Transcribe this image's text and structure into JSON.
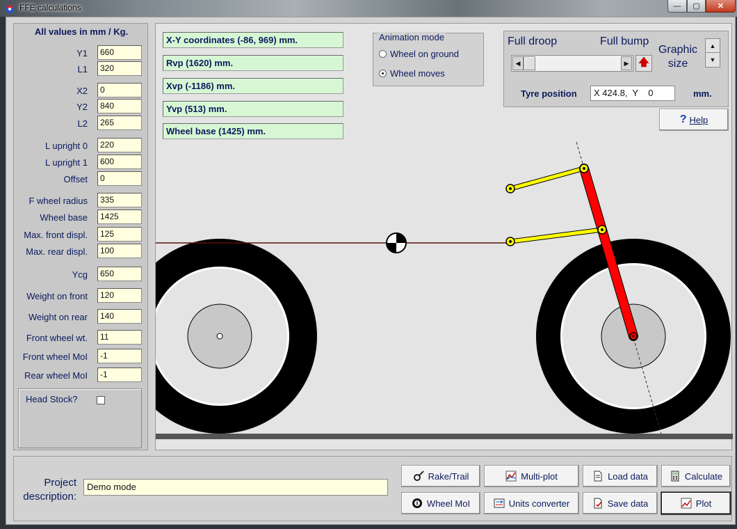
{
  "window": {
    "title": "FFE calculations",
    "minimize": "—",
    "maximize": "▢",
    "close": "✕"
  },
  "left_panel": {
    "header": "All values in mm / Kg.",
    "params": [
      {
        "label": "Y1",
        "value": "660"
      },
      {
        "label": "L1",
        "value": "320"
      },
      {
        "label": "X2",
        "value": "0"
      },
      {
        "label": "Y2",
        "value": "840"
      },
      {
        "label": "L2",
        "value": "265"
      },
      {
        "label": "L upright 0",
        "value": "220"
      },
      {
        "label": "L upright 1",
        "value": "600"
      },
      {
        "label": "Offset",
        "value": "0"
      },
      {
        "label": "F wheel radius",
        "value": "335"
      },
      {
        "label": "Wheel base",
        "value": "1425"
      },
      {
        "label": "Max. front displ.",
        "value": "125"
      },
      {
        "label": "Max. rear displ.",
        "value": "100"
      },
      {
        "label": "Ycg",
        "value": "650"
      },
      {
        "label": "Weight on front",
        "value": "120"
      },
      {
        "label": "Weight on rear",
        "value": "140"
      },
      {
        "label": "Front wheel wt.",
        "value": "11"
      },
      {
        "label": "Front wheel MoI",
        "value": "-1"
      },
      {
        "label": "Rear wheel MoI",
        "value": "-1"
      }
    ],
    "head_stock_label": "Head Stock?",
    "head_stock_checked": false
  },
  "info": [
    "X-Y coordinates (-86, 969) mm.",
    "Rvp (1620) mm.",
    "Xvp (-1186) mm.",
    "Yvp (513) mm.",
    "Wheel base (1425) mm."
  ],
  "animation": {
    "legend": "Animation mode",
    "options": [
      {
        "label": "Wheel on ground",
        "checked": false
      },
      {
        "label": "Wheel moves",
        "checked": true
      }
    ]
  },
  "controls": {
    "full_droop": "Full droop",
    "full_bump": "Full bump",
    "graphic_size": "Graphic size",
    "scroll_left": "◀",
    "scroll_right": "▶",
    "spin_up": "▲",
    "spin_down": "▼",
    "tyre_position_label": "Tyre position",
    "tyre_position_value": "X 424.8,  Y    0",
    "tyre_position_unit": "mm.",
    "help_label": "Help"
  },
  "colors": {
    "upright": "#ff0000",
    "wishbones": "#ffff00",
    "info_bg": "#d7f7d4",
    "input_bg": "#ffffe0",
    "text": "#0a1a5c"
  },
  "bottom": {
    "project_label": "Project description:",
    "project_value": "Demo mode",
    "buttons": {
      "rake_trail": "Rake/Trail",
      "multi_plot": "Multi-plot",
      "load_data": "Load data",
      "calculate": "Calculate",
      "wheel_moi": "Wheel MoI",
      "units_converter": "Units converter",
      "save_data": "Save data",
      "plot": "Plot"
    }
  }
}
